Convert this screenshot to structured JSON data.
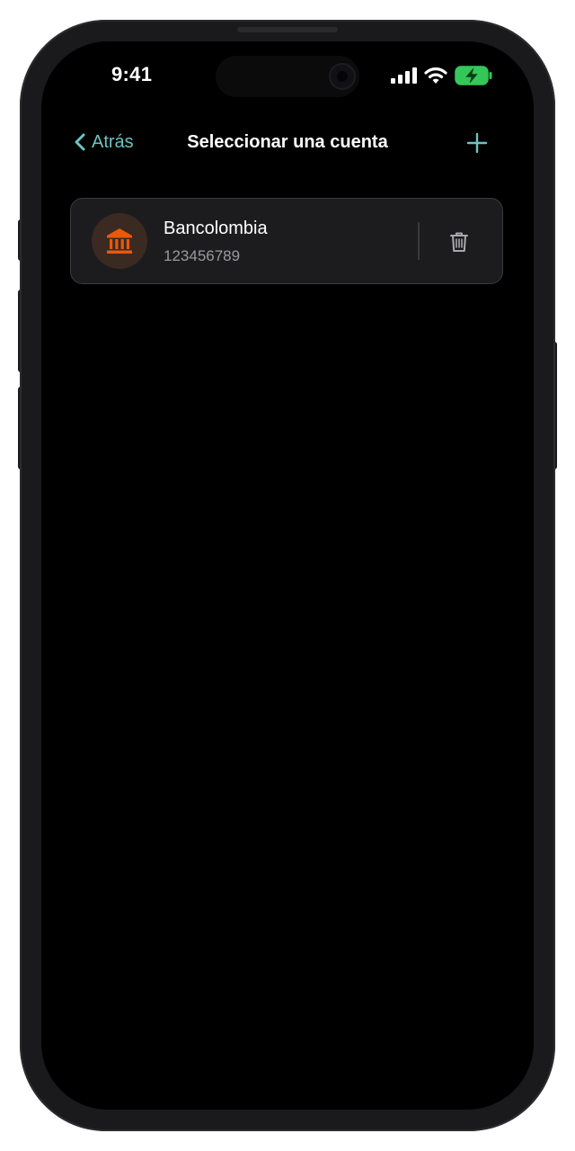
{
  "status_bar": {
    "time": "9:41",
    "icons": [
      "cellular-signal-icon",
      "wifi-icon",
      "battery-charging-icon"
    ],
    "battery_color": "#34c759"
  },
  "nav": {
    "back_label": "Atrás",
    "title": "Seleccionar una cuenta",
    "add_icon": "plus-icon",
    "accent_color": "#6fc3be"
  },
  "accounts": [
    {
      "bank_name": "Bancolombia",
      "account_number": "123456789",
      "icon": "bank-icon",
      "icon_color": "#e8590c",
      "action_icon": "trash-icon"
    }
  ]
}
